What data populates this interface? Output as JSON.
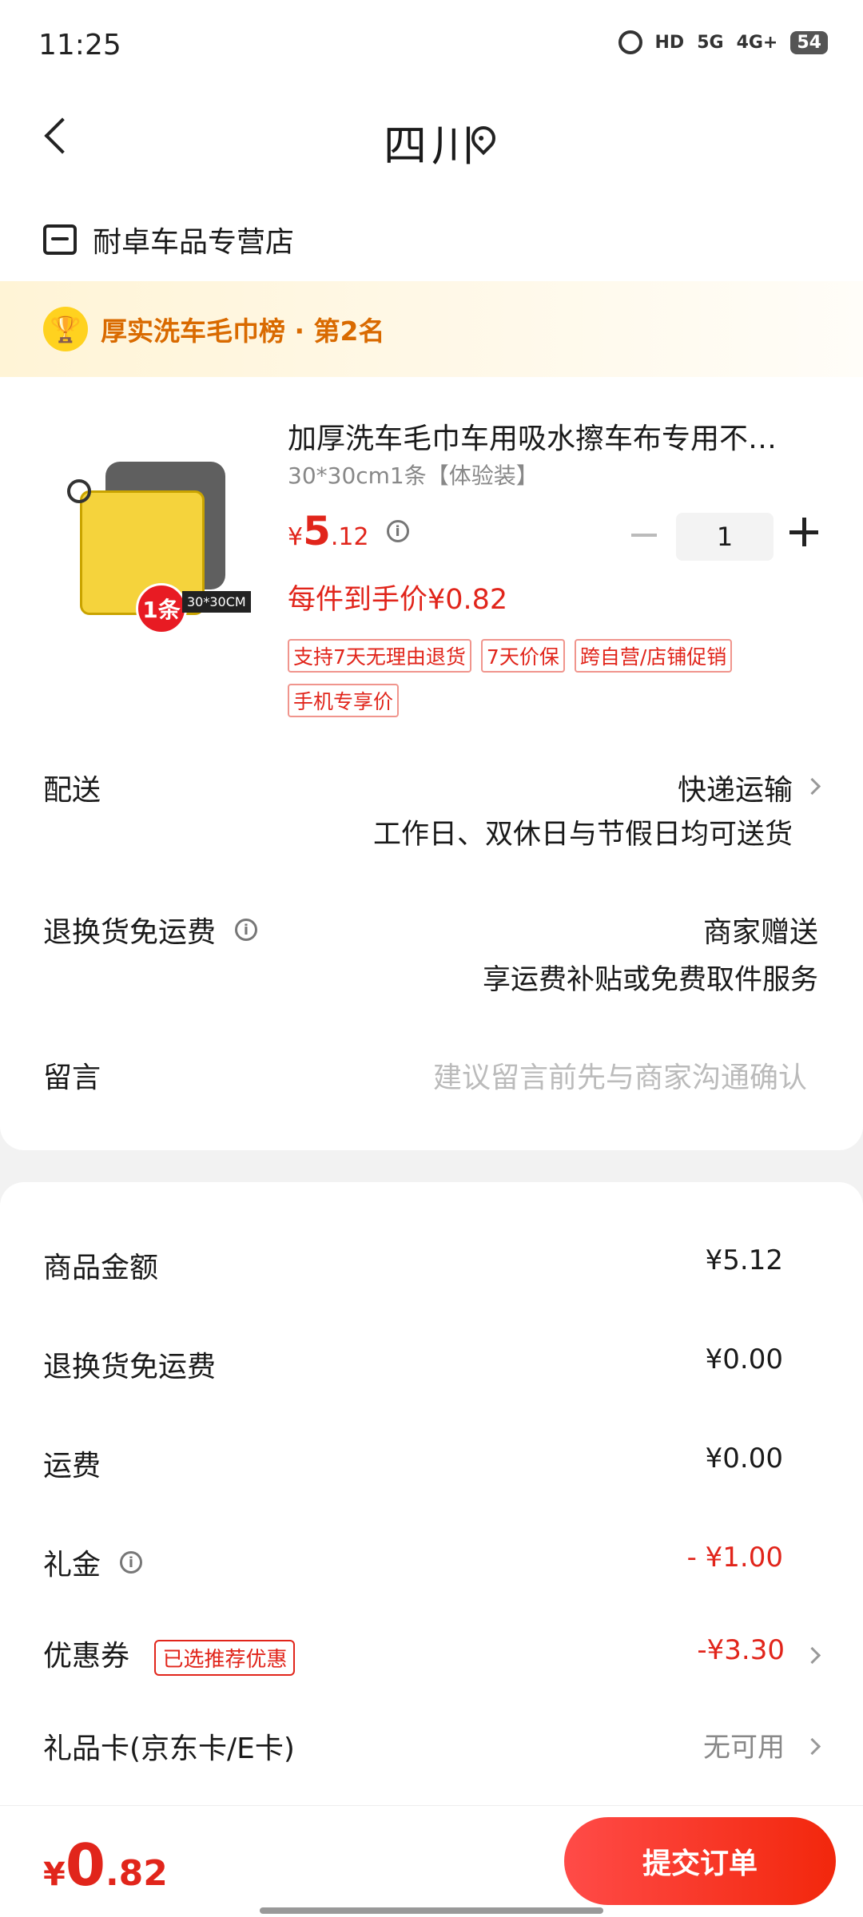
{
  "status_bar": {
    "time": "11:25",
    "network": [
      "HD",
      "5G",
      "4G+"
    ],
    "battery": "54"
  },
  "nav": {
    "title": "四川"
  },
  "store": {
    "name": "耐卓车品专营店"
  },
  "rank": {
    "icon": "trophy-icon",
    "text": "厚实洗车毛巾榜 · 第2名"
  },
  "product": {
    "title": "加厚洗车毛巾车用吸水擦车布专用不…",
    "spec": "30*30cm1条【体验装】",
    "price_symbol": "¥",
    "price_int": "5",
    "price_dec": ".12",
    "final_price": "每件到手价¥0.82",
    "quantity": "1",
    "image_badge_count": "1条",
    "image_badge_size": "30*30CM",
    "tags": [
      "支持7天无理由退货",
      "7天价保",
      "跨自营/店铺促销",
      "手机专享价"
    ]
  },
  "delivery": {
    "label": "配送",
    "value": "快递运输",
    "sub": "工作日、双休日与节假日均可送货"
  },
  "return_shipping": {
    "label": "退换货免运费",
    "value": "商家赠送",
    "sub": "享运费补贴或免费取件服务"
  },
  "message": {
    "label": "留言",
    "placeholder": "建议留言前先与商家沟通确认"
  },
  "summary": {
    "goods_amount_label": "商品金额",
    "goods_amount": "¥5.12",
    "return_fee_label": "退换货免运费",
    "return_fee": "¥0.00",
    "shipping_label": "运费",
    "shipping": "¥0.00",
    "gift_money_label": "礼金",
    "gift_money": "- ¥1.00",
    "coupon_label": "优惠券",
    "coupon_tag": "已选推荐优惠",
    "coupon": "-¥3.30",
    "gift_card_label": "礼品卡(京东卡/E卡)",
    "gift_card": "无可用"
  },
  "bottom": {
    "total_symbol": "¥",
    "total_int": "0",
    "total_dec": ".82",
    "submit_label": "提交订单"
  },
  "colors": {
    "accent_red": "#e1251b",
    "rank_orange": "#d96a00",
    "trophy_yellow": "#ffd21f"
  }
}
